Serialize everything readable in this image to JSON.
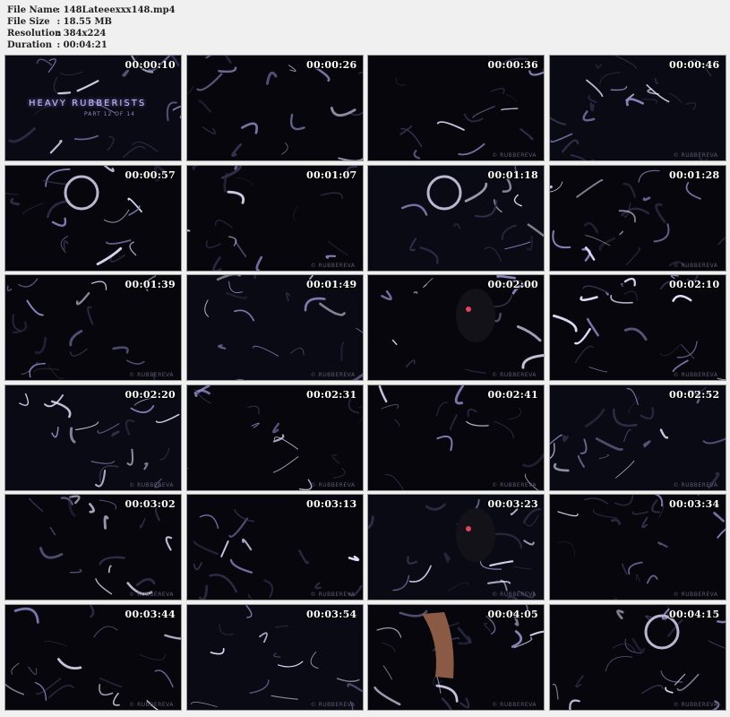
{
  "info": {
    "file_name_label": "File Name",
    "file_name": ": 148Lateeexxx148.mp4",
    "file_size_label": "File Size",
    "file_size": ": 18.55 MB",
    "resolution_label": "Resolution",
    "resolution": ": 384x224",
    "duration_label": "Duration",
    "duration": ": 00:04:21"
  },
  "title_art": {
    "main": "HEAVY RUBBERISTS",
    "sub": "PART 12 OF 14"
  },
  "watermark": "© RUBBEREVA",
  "thumbs": [
    {
      "time": "00:00:10"
    },
    {
      "time": "00:00:26"
    },
    {
      "time": "00:00:36"
    },
    {
      "time": "00:00:46"
    },
    {
      "time": "00:00:57"
    },
    {
      "time": "00:01:07"
    },
    {
      "time": "00:01:18"
    },
    {
      "time": "00:01:28"
    },
    {
      "time": "00:01:39"
    },
    {
      "time": "00:01:49"
    },
    {
      "time": "00:02:00"
    },
    {
      "time": "00:02:10"
    },
    {
      "time": "00:02:20"
    },
    {
      "time": "00:02:31"
    },
    {
      "time": "00:02:41"
    },
    {
      "time": "00:02:52"
    },
    {
      "time": "00:03:02"
    },
    {
      "time": "00:03:13"
    },
    {
      "time": "00:03:23"
    },
    {
      "time": "00:03:34"
    },
    {
      "time": "00:03:44"
    },
    {
      "time": "00:03:54"
    },
    {
      "time": "00:04:05"
    },
    {
      "time": "00:04:15"
    }
  ]
}
